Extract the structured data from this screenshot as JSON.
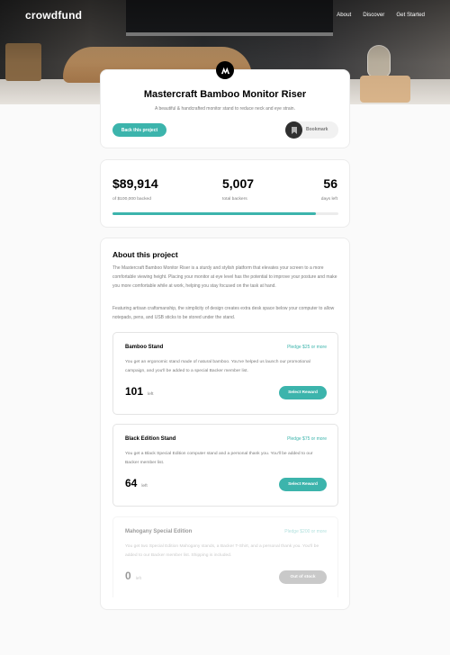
{
  "header": {
    "logo": "crowdfund",
    "nav": [
      "About",
      "Discover",
      "Get Started"
    ]
  },
  "hero": {
    "image": "desk-with-bamboo-monitor-riser"
  },
  "project": {
    "icon": "mastercraft-logo-icon",
    "title": "Mastercraft Bamboo Monitor Riser",
    "subtitle": "A beautiful & handcrafted monitor stand to reduce neck and eye strain.",
    "back_label": "Back this project",
    "bookmark_label": "Bookmark"
  },
  "stats": {
    "backed_value": "$89,914",
    "backed_label": "of $100,000 backed",
    "backers_value": "5,007",
    "backers_label": "total backers",
    "days_value": "56",
    "days_label": "days left",
    "progress": 0.899
  },
  "about": {
    "title": "About this project",
    "paragraphs": [
      "The Mastercraft Bamboo Monitor Riser is a sturdy and stylish platform that elevates your screen to a more comfortable viewing height. Placing your monitor at eye level has the potential to improve your posture and make you more comfortable while at work, helping you stay focused on the task at hand.",
      "Featuring artisan craftsmanship, the simplicity of design creates extra desk space below your computer to allow notepads, pens, and USB sticks to be stored under the stand."
    ]
  },
  "rewards": [
    {
      "name": "Bamboo Stand",
      "pledge": "Pledge $25 or more",
      "description": "You get an ergonomic stand made of natural bamboo. You've helped us launch our promotional campaign, and you'll be added to a special Backer member list.",
      "count": "101",
      "left_label": "left",
      "button": "Select Reward"
    },
    {
      "name": "Black Edition Stand",
      "pledge": "Pledge $75 or more",
      "description": "You get a Black Special Edition computer stand and a personal thank you. You'll be added to our Backer member list.",
      "count": "64",
      "left_label": "left",
      "button": "Select Reward"
    },
    {
      "name": "Mahogany Special Edition",
      "pledge": "Pledge $200 or more",
      "description": "You get two Special Edition Mahogany stands, a Backer T-Shirt, and a personal thank you. You'll be added to our Backer member list. Shipping is included.",
      "count": "0",
      "left_label": "left",
      "button": "Out of stock"
    }
  ],
  "colors": {
    "accent": "#3cb4ac",
    "text_muted": "#7a7a7a",
    "disabled_button": "#7a7a7a"
  }
}
